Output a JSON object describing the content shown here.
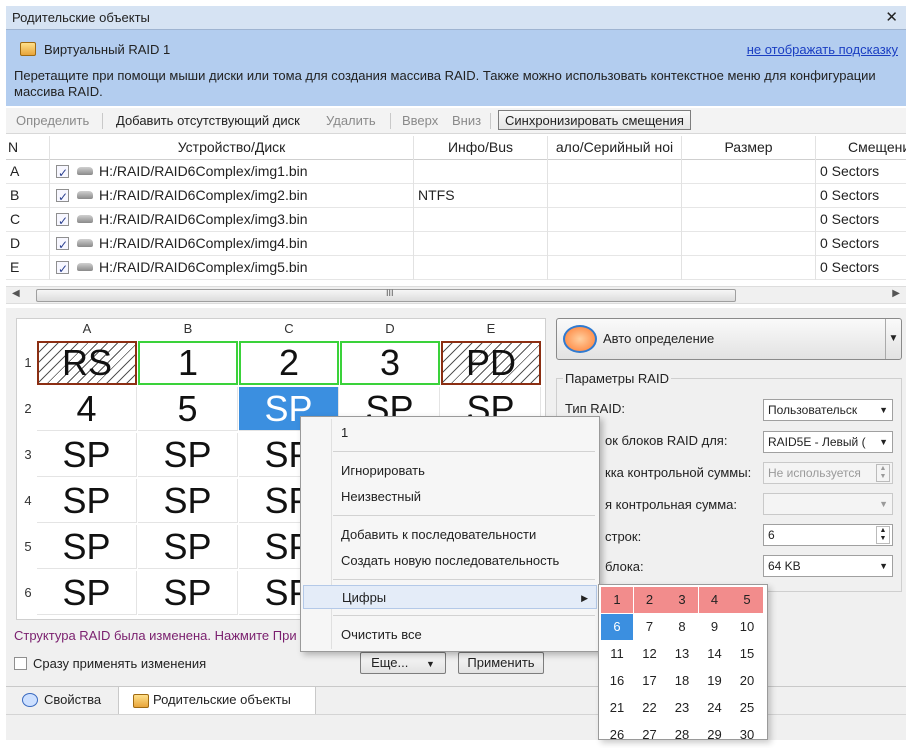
{
  "window": {
    "title": "Родительские объекты",
    "close_glyph": "✕"
  },
  "hint": {
    "title": "Виртуальный RAID 1",
    "hide_link": "не отображать подсказку",
    "text": "Перетащите при помощи мыши диски или тома для создания массива RAID. Также можно использовать контекстное меню для конфигурации массива RAID."
  },
  "toolbar": {
    "detect": "Определить",
    "add_missing": "Добавить отсутствующий диск",
    "delete": "Удалить",
    "up": "Вверх",
    "down": "Вниз",
    "sync_offsets": "Синхронизировать смещения"
  },
  "table": {
    "headers": [
      "N",
      "Устройство/Диск",
      "Инфо/Bus",
      "ало/Серийный ноі",
      "Размер",
      "Смещени"
    ],
    "rows": [
      {
        "n": "A",
        "device": "H:/RAID/RAID6Complex/img1.bin",
        "info": "",
        "serial": "",
        "size": "",
        "offset": "0 Sectors"
      },
      {
        "n": "B",
        "device": "H:/RAID/RAID6Complex/img2.bin",
        "info": "NTFS",
        "serial": "",
        "size": "",
        "offset": "0 Sectors"
      },
      {
        "n": "C",
        "device": "H:/RAID/RAID6Complex/img3.bin",
        "info": "",
        "serial": "",
        "size": "",
        "offset": "0 Sectors"
      },
      {
        "n": "D",
        "device": "H:/RAID/RAID6Complex/img4.bin",
        "info": "",
        "serial": "",
        "size": "",
        "offset": "0 Sectors"
      },
      {
        "n": "E",
        "device": "H:/RAID/RAID6Complex/img5.bin",
        "info": "",
        "serial": "",
        "size": "",
        "offset": "0 Sectors"
      }
    ],
    "scroll_grip": "III"
  },
  "grid": {
    "columns": [
      "A",
      "B",
      "C",
      "D",
      "E"
    ],
    "rows": [
      "1",
      "2",
      "3",
      "4",
      "5",
      "6"
    ],
    "cells": [
      [
        "RS",
        "1",
        "2",
        "3",
        "PD"
      ],
      [
        "4",
        "5",
        "SP",
        "SP",
        "SP"
      ],
      [
        "SP",
        "SP",
        "SP",
        "",
        ""
      ],
      [
        "SP",
        "SP",
        "SP",
        "",
        ""
      ],
      [
        "SP",
        "SP",
        "SP",
        "",
        ""
      ],
      [
        "SP",
        "SP",
        "SP",
        "",
        ""
      ]
    ]
  },
  "right": {
    "auto_detect": "Авто определение",
    "params_title": "Параметры RAID",
    "raid_type_label": "Тип RAID:",
    "raid_type_value": "Пользовательск",
    "block_order_label": "ок блоков RAID для:",
    "block_order_value": "RAID5E - Левый (",
    "checksum_label": "кка контрольной суммы:",
    "checksum_value": "Не используется",
    "checksum2_label": "я контрольная сумма:",
    "checksum2_value": "",
    "rows_label": "строк:",
    "rows_value": "6",
    "block_size_label": "блока:",
    "block_size_value": "64 KB"
  },
  "footer": {
    "status": "Структура RAID была изменена. Нажмите При",
    "apply_immediately": "Сразу применять изменения",
    "more_button": "Еще...",
    "apply_button": "Применить"
  },
  "tabs": {
    "properties": "Свойства",
    "parent_objects": "Родительские объекты"
  },
  "context_menu": {
    "header": "1",
    "ignore": "Игнорировать",
    "unknown": "Неизвестный",
    "add_to_sequence": "Добавить к последовательности",
    "new_sequence": "Создать новую последовательность",
    "digits": "Цифры",
    "clear_all": "Очистить все"
  },
  "number_grid": {
    "values": [
      [
        "1",
        "2",
        "3",
        "4",
        "5"
      ],
      [
        "6",
        "7",
        "8",
        "9",
        "10"
      ],
      [
        "11",
        "12",
        "13",
        "14",
        "15"
      ],
      [
        "16",
        "17",
        "18",
        "19",
        "20"
      ],
      [
        "21",
        "22",
        "23",
        "24",
        "25"
      ],
      [
        "26",
        "27",
        "28",
        "29",
        "30"
      ]
    ],
    "used": [
      "1",
      "2",
      "3",
      "4",
      "5"
    ],
    "current": "6"
  },
  "colors": {
    "hint_bg": "#b3cdef",
    "data_border": "#3ad23a",
    "parity_border": "#8b2e12",
    "selected": "#3b8fe0",
    "used_number": "#f28c8c",
    "link": "#1a3ec2"
  },
  "icons": [
    "raid-array-icon",
    "checkbox-checked-icon",
    "disk-icon",
    "auto-detect-icon",
    "properties-icon",
    "submenu-arrow-icon"
  ]
}
